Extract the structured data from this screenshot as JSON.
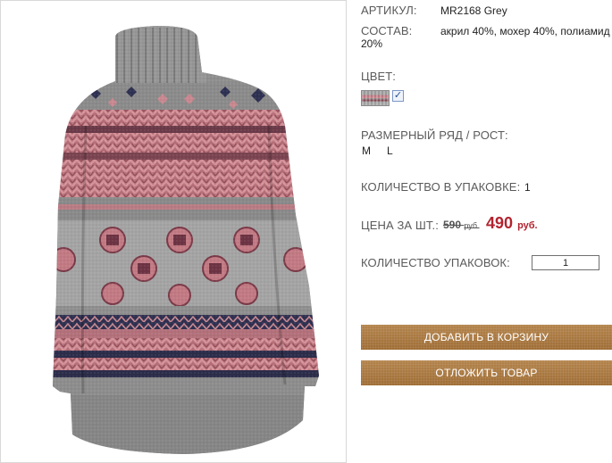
{
  "product": {
    "article": {
      "label": "АРТИКУЛ:",
      "value": "MR2168 Grey"
    },
    "composition": {
      "label": "СОСТАВ:",
      "value_line1": "акрил 40%, мохер 40%, полиамид",
      "value_line2": "20%"
    },
    "color": {
      "label": "ЦВЕТ:",
      "swatch_checked": true
    },
    "sizes": {
      "label": "РАЗМЕРНЫЙ РЯД / РОСТ:",
      "items": [
        "M",
        "L"
      ]
    },
    "pack_qty": {
      "label": "КОЛИЧЕСТВО В УПАКОВКЕ:",
      "value": "1"
    },
    "price": {
      "label": "ЦЕНА ЗА ШТ.:",
      "old": "590",
      "old_currency": "руб.",
      "new": "490",
      "new_currency": "руб."
    },
    "packs": {
      "label": "КОЛИЧЕСТВО УПАКОВОК:",
      "value": "1"
    }
  },
  "actions": {
    "add_to_cart": "ДОБАВИТЬ В КОРЗИНУ",
    "postpone": "ОТЛОЖИТЬ ТОВАР"
  },
  "colors": {
    "label": "#5a5a5a",
    "price_new": "#b2232f",
    "button": "#a8773e",
    "sweater_grey": "#8a8a8a",
    "sweater_pink": "#c07880",
    "sweater_navy": "#2b2c48"
  }
}
